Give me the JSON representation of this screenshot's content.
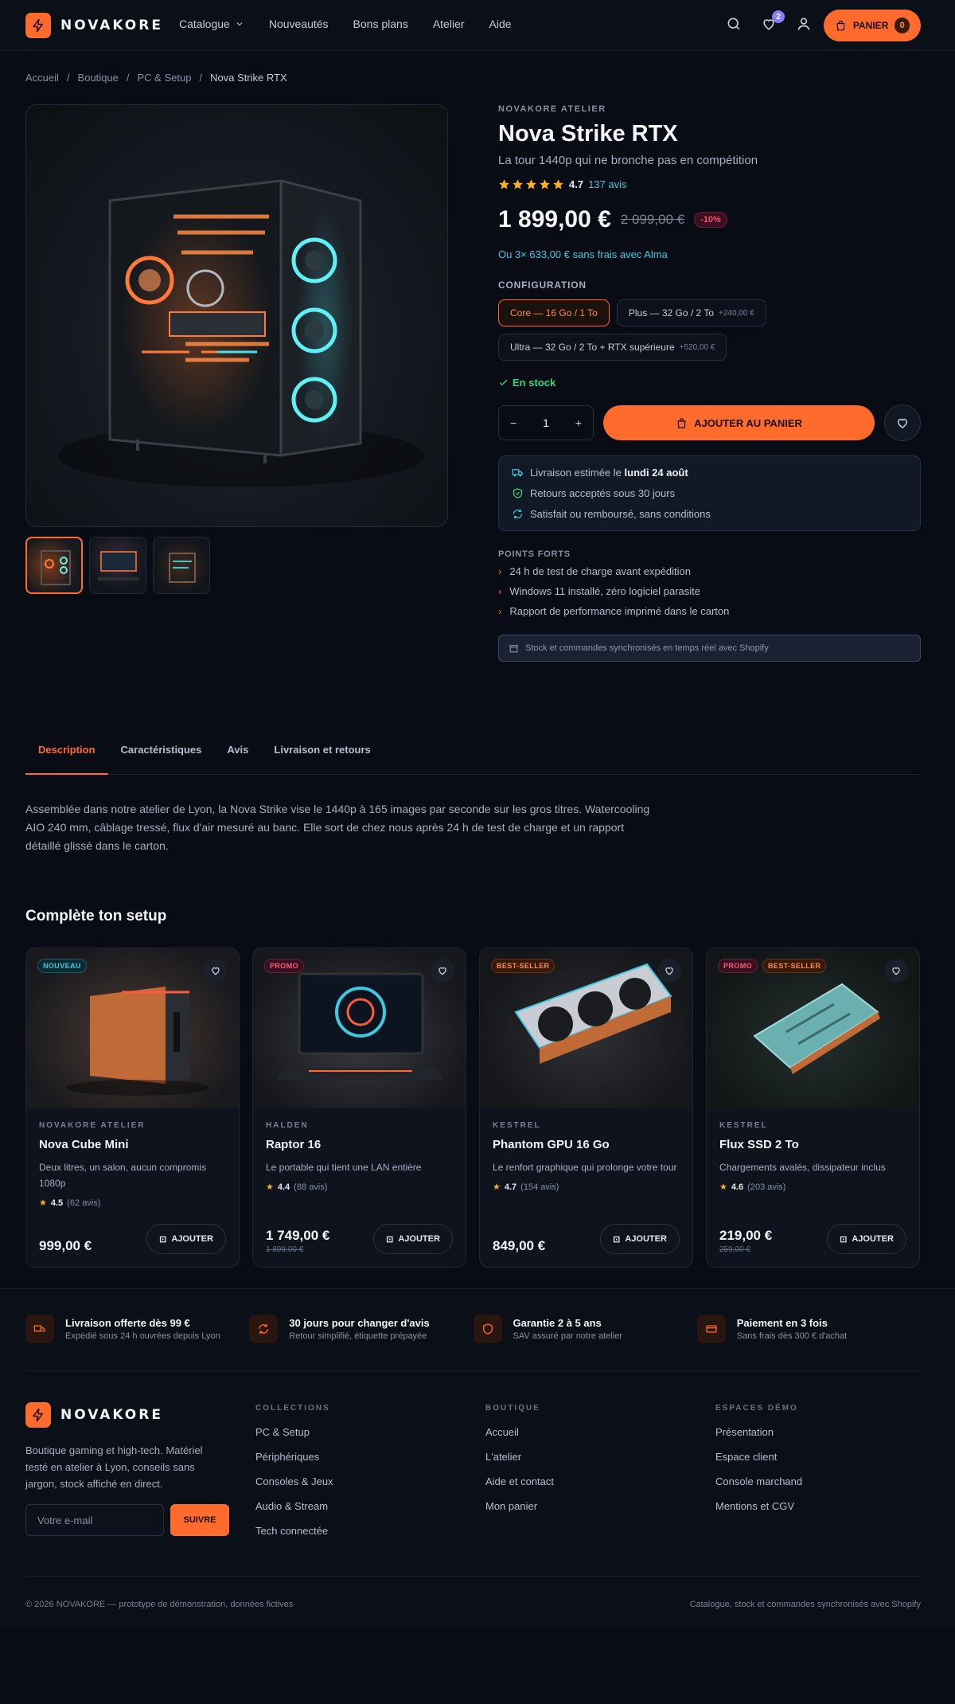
{
  "header": {
    "logo_text": "NOVAKORE",
    "nav": [
      "Catalogue",
      "Nouveautés",
      "Bons plans",
      "Atelier",
      "Aide"
    ],
    "wishlist_count": "2",
    "cart_label": "PANIER",
    "cart_count": "0"
  },
  "breadcrumb": [
    "Accueil",
    "Boutique",
    "PC & Setup",
    "Nova Strike RTX"
  ],
  "product": {
    "eyebrow": "NOVAKORE ATELIER",
    "title": "Nova Strike RTX",
    "subtitle": "La tour 1440p qui ne bronche pas en compétition",
    "rating": "4.7",
    "reviews": "137 avis",
    "price": "1 899,00 €",
    "old_price": "2 099,00 €",
    "discount": "-10%",
    "installments": "Ou 3× 633,00 € sans frais avec Alma",
    "config_label": "CONFIGURATION",
    "options": [
      {
        "label": "Core — 16 Go / 1 To",
        "extra": ""
      },
      {
        "label": "Plus — 32 Go / 2 To",
        "extra": "+240,00 €"
      },
      {
        "label": "Ultra — 32 Go / 2 To + RTX supérieure",
        "extra": "+520,00 €"
      }
    ],
    "stock": "En stock",
    "qty": "1",
    "add_label": "AJOUTER AU PANIER",
    "delivery_prefix": "Livraison estimée le",
    "delivery_date": "lundi 24 août",
    "returns": "Retours acceptés sous 30 jours",
    "refund": "Satisfait ou remboursé, sans conditions",
    "highlights_label": "POINTS FORTS",
    "highlights": [
      "24 h de test de charge avant expédition",
      "Windows 11 installé, zéro logiciel parasite",
      "Rapport de performance imprimé dans le carton"
    ],
    "sync_note": "Stock et commandes synchronisés en temps réel avec Shopify"
  },
  "tabs": [
    "Description",
    "Caractéristiques",
    "Avis",
    "Livraison et retours"
  ],
  "description": "Assemblée dans notre atelier de Lyon, la Nova Strike vise le 1440p à 165 images par seconde sur les gros titres. Watercooling AIO 240 mm, câblage tressé, flux d'air mesuré au banc. Elle sort de chez nous après 24 h de test de charge et un rapport détaillé glissé dans le carton.",
  "setup": {
    "title": "Complète ton setup",
    "add_label": "AJOUTER",
    "cards": [
      {
        "tags": [
          "NOUVEAU"
        ],
        "brand": "NOVAKORE ATELIER",
        "name": "Nova Cube Mini",
        "desc": "Deux litres, un salon, aucun compromis 1080p",
        "rating": "4.5",
        "reviews": "(62 avis)",
        "price": "999,00 €",
        "old_price": ""
      },
      {
        "tags": [
          "PROMO"
        ],
        "brand": "HALDEN",
        "name": "Raptor 16",
        "desc": "Le portable qui tient une LAN entière",
        "rating": "4.4",
        "reviews": "(88 avis)",
        "price": "1 749,00 €",
        "old_price": "1 899,00 €"
      },
      {
        "tags": [
          "BEST-SELLER"
        ],
        "brand": "KESTREL",
        "name": "Phantom GPU 16 Go",
        "desc": "Le renfort graphique qui prolonge votre tour",
        "rating": "4.7",
        "reviews": "(154 avis)",
        "price": "849,00 €",
        "old_price": ""
      },
      {
        "tags": [
          "PROMO",
          "BEST-SELLER"
        ],
        "brand": "KESTREL",
        "name": "Flux SSD 2 To",
        "desc": "Chargements avalés, dissipateur inclus",
        "rating": "4.6",
        "reviews": "(203 avis)",
        "price": "219,00 €",
        "old_price": "259,00 €"
      }
    ]
  },
  "perks": [
    {
      "title": "Livraison offerte dès 99 €",
      "sub": "Expédié sous 24 h ouvrées depuis Lyon"
    },
    {
      "title": "30 jours pour changer d'avis",
      "sub": "Retour simplifié, étiquette prépayée"
    },
    {
      "title": "Garantie 2 à 5 ans",
      "sub": "SAV assuré par notre atelier"
    },
    {
      "title": "Paiement en 3 fois",
      "sub": "Sans frais dès 300 € d'achat"
    }
  ],
  "footer": {
    "about": "Boutique gaming et high-tech. Matériel testé en atelier à Lyon, conseils sans jargon, stock affiché en direct.",
    "email_placeholder": "Votre e-mail",
    "subscribe": "SUIVRE",
    "columns": [
      {
        "title": "COLLECTIONS",
        "links": [
          "PC & Setup",
          "Périphériques",
          "Consoles & Jeux",
          "Audio & Stream",
          "Tech connectée"
        ]
      },
      {
        "title": "BOUTIQUE",
        "links": [
          "Accueil",
          "L'atelier",
          "Aide et contact",
          "Mon panier"
        ]
      },
      {
        "title": "ESPACES DÉMO",
        "links": [
          "Présentation",
          "Espace client",
          "Console marchand",
          "Mentions et CGV"
        ]
      }
    ],
    "copyright": "© 2026 NOVAKORE — prototype de démonstration, données fictives",
    "sync": "Catalogue, stock et commandes synchronisés avec Shopify"
  },
  "colors": {
    "accent": "#ff6b2c",
    "cyan": "#3fc8e0",
    "success": "#3ed47a",
    "bg": "#090c14"
  }
}
